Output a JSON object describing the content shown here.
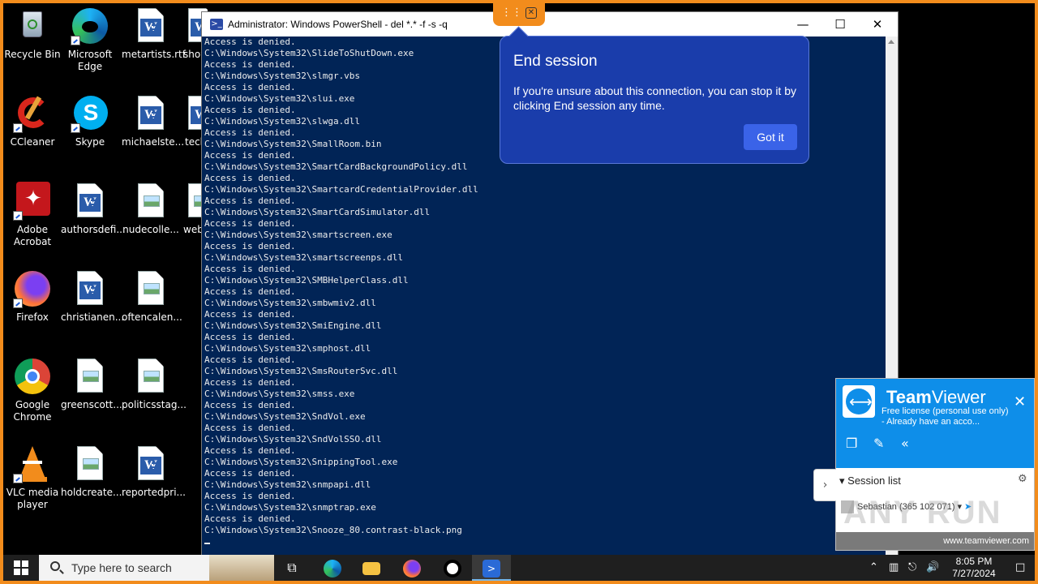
{
  "desktop_icons": [
    {
      "label": "Recycle Bin",
      "icon": "recycle-bin-icon"
    },
    {
      "label": "Microsoft Edge",
      "icon": "edge-icon"
    },
    {
      "label": "metartists.rtf",
      "icon": "word-doc-icon"
    },
    {
      "label": "show",
      "icon": "word-doc-icon"
    },
    {
      "label": "CCleaner",
      "icon": "ccleaner-icon"
    },
    {
      "label": "Skype",
      "icon": "skype-icon"
    },
    {
      "label": "michaelste...",
      "icon": "word-doc-icon"
    },
    {
      "label": "tech",
      "icon": "word-doc-icon"
    },
    {
      "label": "Adobe Acrobat",
      "icon": "acrobat-icon"
    },
    {
      "label": "authorsdefi...",
      "icon": "word-doc-icon"
    },
    {
      "label": "nudecolle...",
      "icon": "image-file-icon"
    },
    {
      "label": "web",
      "icon": "image-file-icon"
    },
    {
      "label": "Firefox",
      "icon": "firefox-icon"
    },
    {
      "label": "christianen...",
      "icon": "word-doc-icon"
    },
    {
      "label": "oftencalen...",
      "icon": "image-file-icon"
    },
    {
      "label": "Google Chrome",
      "icon": "chrome-icon"
    },
    {
      "label": "greenscott....",
      "icon": "image-file-icon"
    },
    {
      "label": "politicsstag...",
      "icon": "image-file-icon"
    },
    {
      "label": "VLC media player",
      "icon": "vlc-icon"
    },
    {
      "label": "holdcreate....",
      "icon": "image-file-icon"
    },
    {
      "label": "reportedpri...",
      "icon": "word-doc-icon"
    }
  ],
  "powershell": {
    "title": "Administrator: Windows PowerShell - del *.* -f -s -q",
    "icon": "powershell-icon",
    "lines": [
      "Access is denied.",
      "C:\\Windows\\System32\\SlideToShutDown.exe",
      "Access is denied.",
      "C:\\Windows\\System32\\slmgr.vbs",
      "Access is denied.",
      "C:\\Windows\\System32\\slui.exe",
      "Access is denied.",
      "C:\\Windows\\System32\\slwga.dll",
      "Access is denied.",
      "C:\\Windows\\System32\\SmallRoom.bin",
      "Access is denied.",
      "C:\\Windows\\System32\\SmartCardBackgroundPolicy.dll",
      "Access is denied.",
      "C:\\Windows\\System32\\SmartcardCredentialProvider.dll",
      "Access is denied.",
      "C:\\Windows\\System32\\SmartCardSimulator.dll",
      "Access is denied.",
      "C:\\Windows\\System32\\smartscreen.exe",
      "Access is denied.",
      "C:\\Windows\\System32\\smartscreenps.dll",
      "Access is denied.",
      "C:\\Windows\\System32\\SMBHelperClass.dll",
      "Access is denied.",
      "C:\\Windows\\System32\\smbwmiv2.dll",
      "Access is denied.",
      "C:\\Windows\\System32\\SmiEngine.dll",
      "Access is denied.",
      "C:\\Windows\\System32\\smphost.dll",
      "Access is denied.",
      "C:\\Windows\\System32\\SmsRouterSvc.dll",
      "Access is denied.",
      "C:\\Windows\\System32\\smss.exe",
      "Access is denied.",
      "C:\\Windows\\System32\\SndVol.exe",
      "Access is denied.",
      "C:\\Windows\\System32\\SndVolSSO.dll",
      "Access is denied.",
      "C:\\Windows\\System32\\SnippingTool.exe",
      "Access is denied.",
      "C:\\Windows\\System32\\snmpapi.dll",
      "Access is denied.",
      "C:\\Windows\\System32\\snmptrap.exe",
      "Access is denied.",
      "C:\\Windows\\System32\\Snooze_80.contrast-black.png"
    ],
    "colors": {
      "background": "#012456",
      "text": "#ededed"
    }
  },
  "end_session": {
    "title": "End session",
    "body": "If you're unsure about this connection, you can stop it by clicking End session any time.",
    "button": "Got it"
  },
  "teamviewer": {
    "name_bold": "Team",
    "name_regular": "Viewer",
    "license": "Free license (personal use only) - Already have an acco...",
    "session_list": "Session list",
    "session_user": "Sebastian (365 102 071)",
    "url": "www.teamviewer.com"
  },
  "taskbar": {
    "search_placeholder": "Type here to search",
    "time": "8:05 PM",
    "date": "7/27/2024"
  },
  "watermark": "ANY RUN",
  "accent_color": "#f28c1c"
}
